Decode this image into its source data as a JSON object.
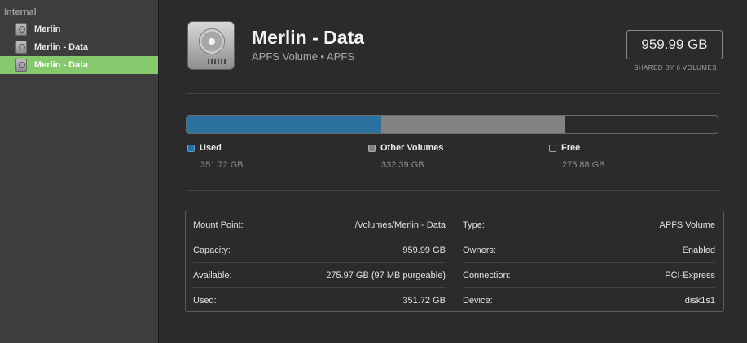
{
  "sidebar": {
    "section_header": "Internal",
    "items": [
      {
        "label": "Merlin",
        "icon": "internal-disk-icon"
      },
      {
        "label": "Merlin - Data",
        "icon": "internal-disk-icon"
      },
      {
        "label": "Merlin - Data",
        "icon": "internal-disk-icon",
        "selected": true
      }
    ]
  },
  "header": {
    "title": "Merlin - Data",
    "subtitle": "APFS Volume • APFS",
    "capacity": "959.99 GB",
    "shared_caption": "SHARED BY 6 VOLUMES",
    "icon": "hard-drive-icon"
  },
  "usage": {
    "segments": [
      {
        "label": "Used",
        "value": "351.72 GB",
        "fraction": 0.3664,
        "color": "#2a71a0"
      },
      {
        "label": "Other Volumes",
        "value": "332.39 GB",
        "fraction": 0.3462,
        "color": "#838385"
      },
      {
        "label": "Free",
        "value": "275.88 GB",
        "fraction": 0.2874,
        "color": "#2b2b2d"
      }
    ]
  },
  "info": {
    "left": [
      {
        "key": "Mount Point:",
        "value": "/Volumes/Merlin - Data"
      },
      {
        "key": "Capacity:",
        "value": "959.99 GB"
      },
      {
        "key": "Available:",
        "value": "275.97 GB (97 MB purgeable)"
      },
      {
        "key": "Used:",
        "value": "351.72 GB"
      }
    ],
    "right": [
      {
        "key": "Type:",
        "value": "APFS Volume"
      },
      {
        "key": "Owners:",
        "value": "Enabled"
      },
      {
        "key": "Connection:",
        "value": "PCI-Express"
      },
      {
        "key": "Device:",
        "value": "disk1s1"
      }
    ]
  },
  "colors": {
    "selection": "#86c96d",
    "used": "#2a71a0",
    "other": "#838385"
  }
}
